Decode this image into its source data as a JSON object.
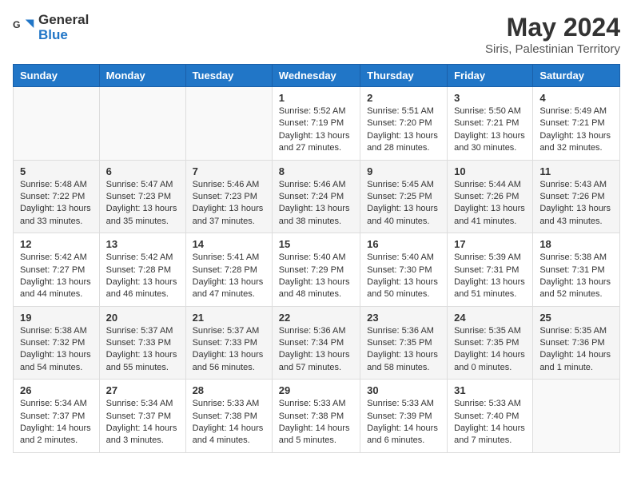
{
  "header": {
    "logo_line1": "General",
    "logo_line2": "Blue",
    "month_year": "May 2024",
    "location": "Siris, Palestinian Territory"
  },
  "weekdays": [
    "Sunday",
    "Monday",
    "Tuesday",
    "Wednesday",
    "Thursday",
    "Friday",
    "Saturday"
  ],
  "weeks": [
    [
      {
        "day": "",
        "content": ""
      },
      {
        "day": "",
        "content": ""
      },
      {
        "day": "",
        "content": ""
      },
      {
        "day": "1",
        "content": "Sunrise: 5:52 AM\nSunset: 7:19 PM\nDaylight: 13 hours and 27 minutes."
      },
      {
        "day": "2",
        "content": "Sunrise: 5:51 AM\nSunset: 7:20 PM\nDaylight: 13 hours and 28 minutes."
      },
      {
        "day": "3",
        "content": "Sunrise: 5:50 AM\nSunset: 7:21 PM\nDaylight: 13 hours and 30 minutes."
      },
      {
        "day": "4",
        "content": "Sunrise: 5:49 AM\nSunset: 7:21 PM\nDaylight: 13 hours and 32 minutes."
      }
    ],
    [
      {
        "day": "5",
        "content": "Sunrise: 5:48 AM\nSunset: 7:22 PM\nDaylight: 13 hours and 33 minutes."
      },
      {
        "day": "6",
        "content": "Sunrise: 5:47 AM\nSunset: 7:23 PM\nDaylight: 13 hours and 35 minutes."
      },
      {
        "day": "7",
        "content": "Sunrise: 5:46 AM\nSunset: 7:23 PM\nDaylight: 13 hours and 37 minutes."
      },
      {
        "day": "8",
        "content": "Sunrise: 5:46 AM\nSunset: 7:24 PM\nDaylight: 13 hours and 38 minutes."
      },
      {
        "day": "9",
        "content": "Sunrise: 5:45 AM\nSunset: 7:25 PM\nDaylight: 13 hours and 40 minutes."
      },
      {
        "day": "10",
        "content": "Sunrise: 5:44 AM\nSunset: 7:26 PM\nDaylight: 13 hours and 41 minutes."
      },
      {
        "day": "11",
        "content": "Sunrise: 5:43 AM\nSunset: 7:26 PM\nDaylight: 13 hours and 43 minutes."
      }
    ],
    [
      {
        "day": "12",
        "content": "Sunrise: 5:42 AM\nSunset: 7:27 PM\nDaylight: 13 hours and 44 minutes."
      },
      {
        "day": "13",
        "content": "Sunrise: 5:42 AM\nSunset: 7:28 PM\nDaylight: 13 hours and 46 minutes."
      },
      {
        "day": "14",
        "content": "Sunrise: 5:41 AM\nSunset: 7:28 PM\nDaylight: 13 hours and 47 minutes."
      },
      {
        "day": "15",
        "content": "Sunrise: 5:40 AM\nSunset: 7:29 PM\nDaylight: 13 hours and 48 minutes."
      },
      {
        "day": "16",
        "content": "Sunrise: 5:40 AM\nSunset: 7:30 PM\nDaylight: 13 hours and 50 minutes."
      },
      {
        "day": "17",
        "content": "Sunrise: 5:39 AM\nSunset: 7:31 PM\nDaylight: 13 hours and 51 minutes."
      },
      {
        "day": "18",
        "content": "Sunrise: 5:38 AM\nSunset: 7:31 PM\nDaylight: 13 hours and 52 minutes."
      }
    ],
    [
      {
        "day": "19",
        "content": "Sunrise: 5:38 AM\nSunset: 7:32 PM\nDaylight: 13 hours and 54 minutes."
      },
      {
        "day": "20",
        "content": "Sunrise: 5:37 AM\nSunset: 7:33 PM\nDaylight: 13 hours and 55 minutes."
      },
      {
        "day": "21",
        "content": "Sunrise: 5:37 AM\nSunset: 7:33 PM\nDaylight: 13 hours and 56 minutes."
      },
      {
        "day": "22",
        "content": "Sunrise: 5:36 AM\nSunset: 7:34 PM\nDaylight: 13 hours and 57 minutes."
      },
      {
        "day": "23",
        "content": "Sunrise: 5:36 AM\nSunset: 7:35 PM\nDaylight: 13 hours and 58 minutes."
      },
      {
        "day": "24",
        "content": "Sunrise: 5:35 AM\nSunset: 7:35 PM\nDaylight: 14 hours and 0 minutes."
      },
      {
        "day": "25",
        "content": "Sunrise: 5:35 AM\nSunset: 7:36 PM\nDaylight: 14 hours and 1 minute."
      }
    ],
    [
      {
        "day": "26",
        "content": "Sunrise: 5:34 AM\nSunset: 7:37 PM\nDaylight: 14 hours and 2 minutes."
      },
      {
        "day": "27",
        "content": "Sunrise: 5:34 AM\nSunset: 7:37 PM\nDaylight: 14 hours and 3 minutes."
      },
      {
        "day": "28",
        "content": "Sunrise: 5:33 AM\nSunset: 7:38 PM\nDaylight: 14 hours and 4 minutes."
      },
      {
        "day": "29",
        "content": "Sunrise: 5:33 AM\nSunset: 7:38 PM\nDaylight: 14 hours and 5 minutes."
      },
      {
        "day": "30",
        "content": "Sunrise: 5:33 AM\nSunset: 7:39 PM\nDaylight: 14 hours and 6 minutes."
      },
      {
        "day": "31",
        "content": "Sunrise: 5:33 AM\nSunset: 7:40 PM\nDaylight: 14 hours and 7 minutes."
      },
      {
        "day": "",
        "content": ""
      }
    ]
  ]
}
